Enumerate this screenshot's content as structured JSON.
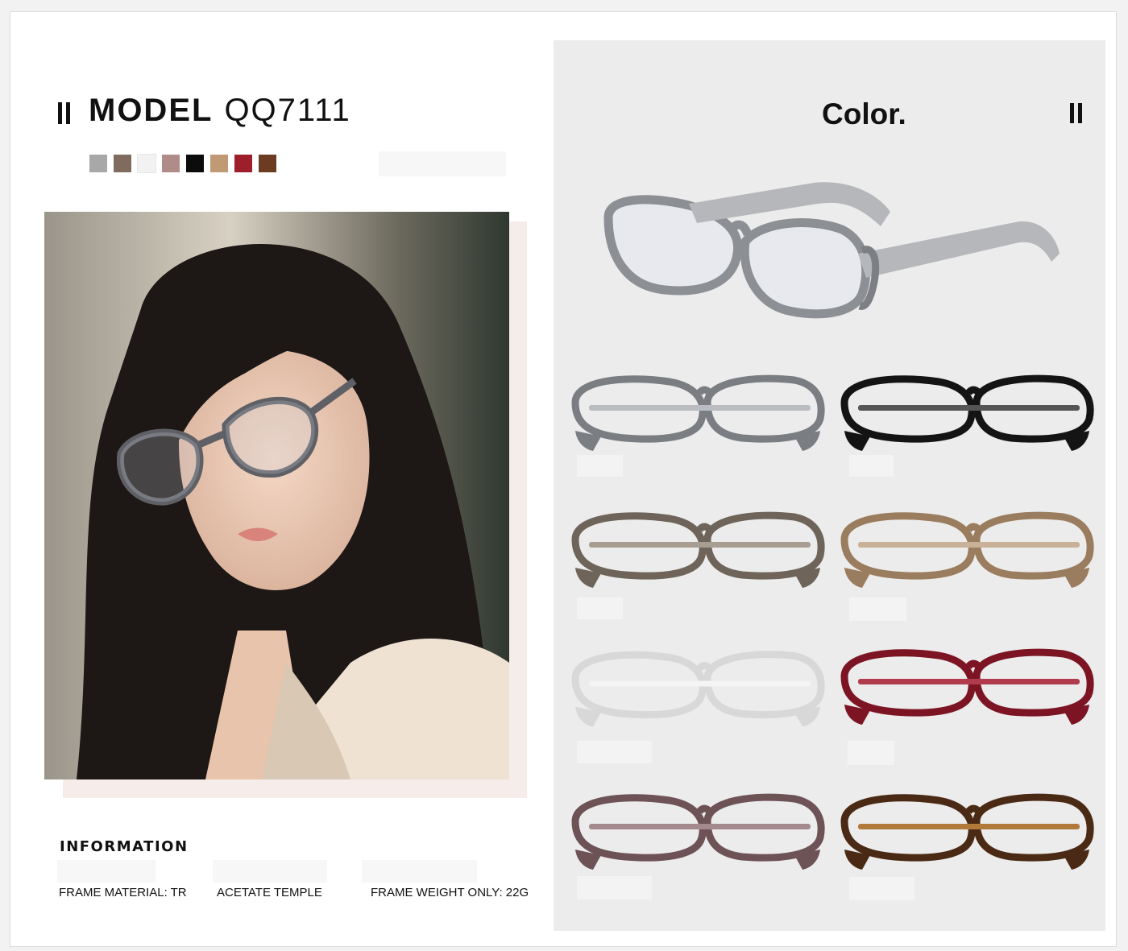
{
  "header": {
    "model_label": "MODEL",
    "model_code": "QQ7111"
  },
  "swatches": [
    "#a7a8a7",
    "#7f6c5e",
    "#f2f2f2",
    "#b08c88",
    "#0c0c0c",
    "#c09a74",
    "#9c1f2b",
    "#6b3c22"
  ],
  "right_panel": {
    "title": "Color."
  },
  "frame_colors": [
    {
      "name": "grey",
      "frame": "#7a7d82",
      "tint": "#b9bcc0"
    },
    {
      "name": "black",
      "frame": "#141414",
      "tint": "#555555"
    },
    {
      "name": "brown-grey",
      "frame": "#6e6459",
      "tint": "#a89d91"
    },
    {
      "name": "light-brown",
      "frame": "#9a7c5e",
      "tint": "#c9b197"
    },
    {
      "name": "clear",
      "frame": "#d8d8d8",
      "tint": "#f4f4f4"
    },
    {
      "name": "wine",
      "frame": "#7c1424",
      "tint": "#b03b4c"
    },
    {
      "name": "mauve",
      "frame": "#6d5256",
      "tint": "#a58a8d"
    },
    {
      "name": "tortoise",
      "frame": "#4a2a14",
      "tint": "#b27a3a"
    }
  ],
  "information": {
    "title": "INFORMATION",
    "items": [
      "FRAME MATERIAL: TR",
      "ACETATE TEMPLE",
      "FRAME WEIGHT ONLY: 22G"
    ]
  }
}
